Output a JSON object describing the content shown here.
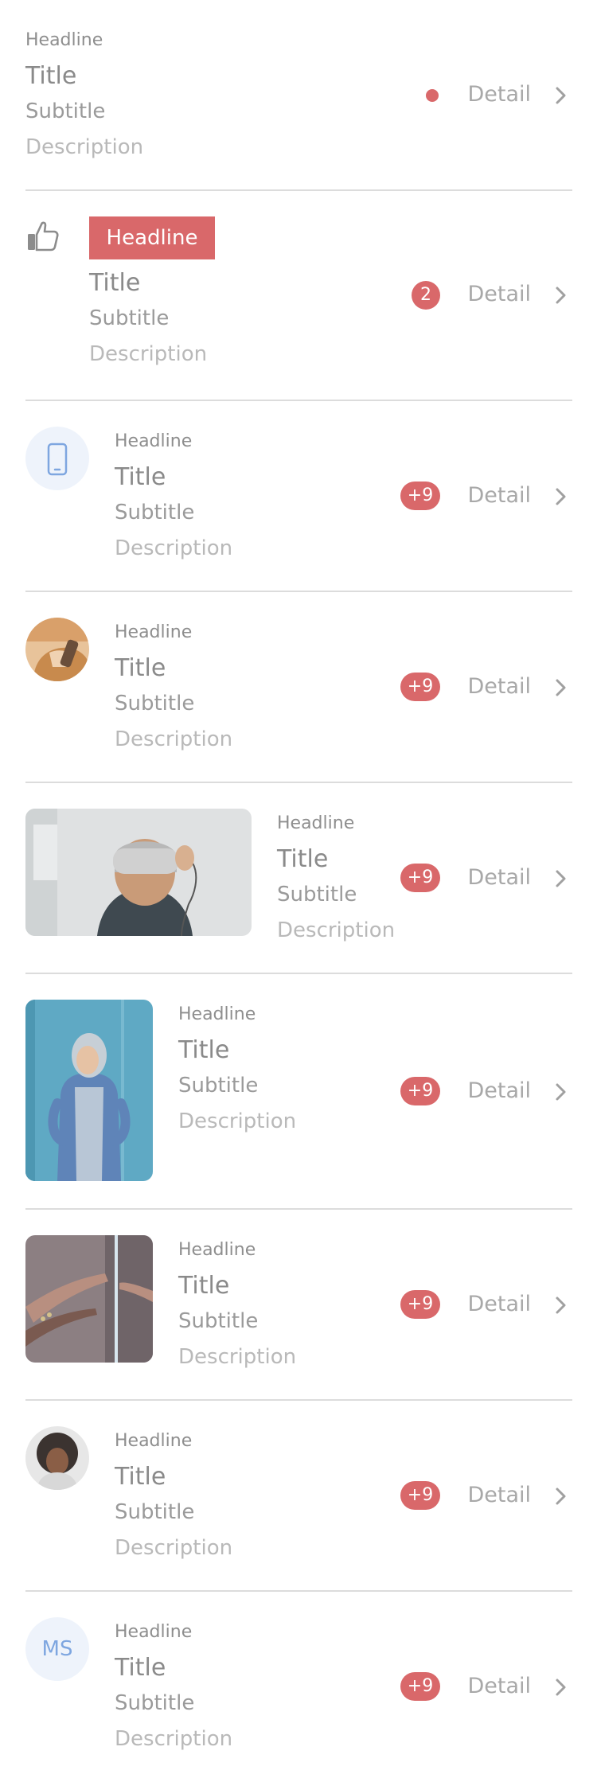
{
  "colors": {
    "accent": "#d9686a",
    "text_primary": "#8a8a8a",
    "divider": "#dcdcdc",
    "avatar_bg": "#eef3fb",
    "avatar_fg": "#7ea6e0"
  },
  "items": [
    {
      "headline": "Headline",
      "title": "Title",
      "subtitle": "Subtitle",
      "description": "Description",
      "detail": "Detail",
      "indicator": "dot"
    },
    {
      "headline": "Headline",
      "title": "Title",
      "subtitle": "Subtitle",
      "description": "Description",
      "detail": "Detail",
      "badge": "2",
      "icon": "thumbs-up-icon"
    },
    {
      "headline": "Headline",
      "title": "Title",
      "subtitle": "Subtitle",
      "description": "Description",
      "detail": "Detail",
      "badge": "+9",
      "icon": "phone-icon"
    },
    {
      "headline": "Headline",
      "title": "Title",
      "subtitle": "Subtitle",
      "description": "Description",
      "detail": "Detail",
      "badge": "+9",
      "image": "avatar-photo"
    },
    {
      "headline": "Headline",
      "title": "Title",
      "subtitle": "Subtitle",
      "description": "Description",
      "detail": "Detail",
      "badge": "+9",
      "image": "vr-headset-photo"
    },
    {
      "headline": "Headline",
      "title": "Title",
      "subtitle": "Subtitle",
      "description": "Description",
      "detail": "Detail",
      "badge": "+9",
      "image": "hoodie-person-photo"
    },
    {
      "headline": "Headline",
      "title": "Title",
      "subtitle": "Subtitle",
      "description": "Description",
      "detail": "Detail",
      "badge": "+9",
      "image": "hands-photo"
    },
    {
      "headline": "Headline",
      "title": "Title",
      "subtitle": "Subtitle",
      "description": "Description",
      "detail": "Detail",
      "badge": "+9",
      "image": "portrait-photo"
    },
    {
      "headline": "Headline",
      "title": "Title",
      "subtitle": "Subtitle",
      "description": "Description",
      "detail": "Detail",
      "badge": "+9",
      "initials": "MS"
    }
  ]
}
